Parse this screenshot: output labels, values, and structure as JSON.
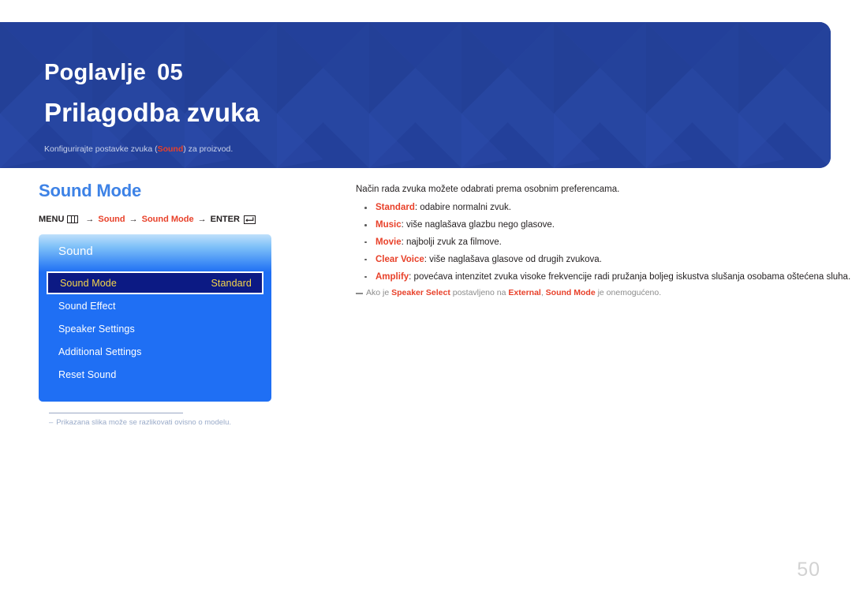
{
  "banner": {
    "chapter_label": "Poglavlje",
    "chapter_number": "05",
    "title": "Prilagodba zvuka",
    "subtitle_before": "Konfigurirajte postavke zvuka (",
    "subtitle_highlight": "Sound",
    "subtitle_after": ") za proizvod.",
    "background_color": "#23409a",
    "highlight_color": "#e8412a"
  },
  "left": {
    "section_title": "Sound Mode",
    "menu_path": {
      "menu_label": "MENU",
      "menu_icon": "menu-bars-icon",
      "arrow": "→",
      "step1": "Sound",
      "step2": "Sound Mode",
      "enter_label": "ENTER",
      "enter_icon": "enter-arrow-icon"
    },
    "osd": {
      "title": "Sound",
      "rows": [
        {
          "label": "Sound Mode",
          "value": "Standard",
          "selected": true
        },
        {
          "label": "Sound Effect",
          "value": "",
          "selected": false
        },
        {
          "label": "Speaker Settings",
          "value": "",
          "selected": false
        },
        {
          "label": "Additional Settings",
          "value": "",
          "selected": false
        },
        {
          "label": "Reset Sound",
          "value": "",
          "selected": false
        }
      ],
      "accent_color": "#1f6ff4",
      "selected_bg": "#0c1a84",
      "selected_text_color": "#f6d64a"
    },
    "note": {
      "dash": "–",
      "text": "Prikazana slika može se razlikovati ovisno o modelu."
    }
  },
  "right": {
    "intro": "Način rada zvuka možete odabrati prema osobnim preferencama.",
    "bullets": [
      {
        "term": "Standard",
        "desc": ": odabire normalni zvuk."
      },
      {
        "term": "Music",
        "desc": ": više naglašava glazbu nego glasove."
      },
      {
        "term": "Movie",
        "desc": ": najbolji zvuk za filmove."
      },
      {
        "term": "Clear Voice",
        "desc": ": više naglašava glasove od drugih zvukova."
      },
      {
        "term": "Amplify",
        "desc": ": povećava intenzitet zvuka visoke frekvencije radi pružanja boljeg iskustva slušanja osobama oštećena sluha."
      }
    ],
    "footnote": {
      "p1": "Ako je ",
      "t1": "Speaker Select",
      "p2": " postavljeno na ",
      "t2": "External",
      "p3": ", ",
      "t3": "Sound Mode",
      "p4": " je onemogućeno."
    }
  },
  "page_number": "50"
}
